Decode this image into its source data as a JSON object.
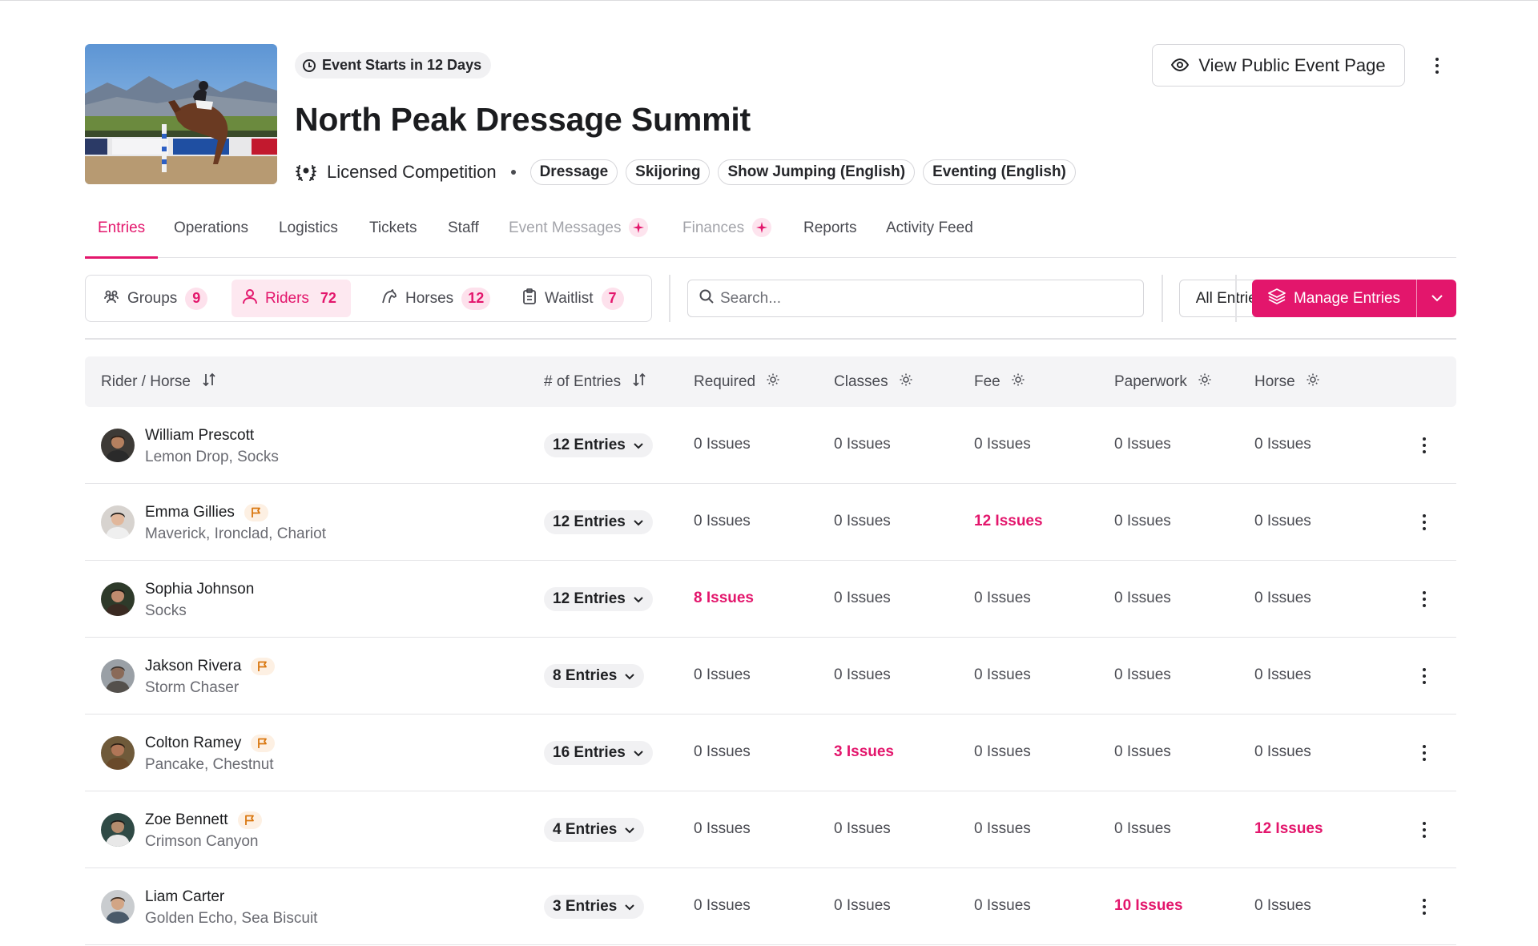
{
  "event": {
    "countdown": "Event Starts in 12 Days",
    "title": "North Peak Dressage Summit",
    "competition_type": "Licensed Competition",
    "disciplines": [
      "Dressage",
      "Skijoring",
      "Show Jumping (English)",
      "Eventing (English)"
    ],
    "view_button": "View Public Event Page"
  },
  "tabs": [
    {
      "label": "Entries",
      "state": "active"
    },
    {
      "label": "Operations",
      "state": "normal"
    },
    {
      "label": "Logistics",
      "state": "normal"
    },
    {
      "label": "Tickets",
      "state": "normal"
    },
    {
      "label": "Staff",
      "state": "normal"
    },
    {
      "label": "Event Messages",
      "state": "disabled"
    },
    {
      "label": "Finances",
      "state": "disabled"
    },
    {
      "label": "Reports",
      "state": "normal"
    },
    {
      "label": "Activity Feed",
      "state": "normal"
    }
  ],
  "segments": [
    {
      "label": "Groups",
      "count": "9",
      "icon": "groups-icon"
    },
    {
      "label": "Riders",
      "count": "72",
      "icon": "rider-icon",
      "active": true
    },
    {
      "label": "Horses",
      "count": "12",
      "icon": "horse-icon"
    },
    {
      "label": "Waitlist",
      "count": "7",
      "icon": "clipboard-icon"
    }
  ],
  "search": {
    "placeholder": "Search..."
  },
  "filter": {
    "selected": "All Entries"
  },
  "manage": {
    "label": "Manage Entries"
  },
  "table": {
    "headers": [
      "Rider / Horse",
      "# of Entries",
      "Required",
      "Classes",
      "Fee",
      "Paperwork",
      "Horse"
    ],
    "rows": [
      {
        "name": "William Prescott",
        "horses": "Lemon Drop, Socks",
        "flag": false,
        "entries": "12 Entries",
        "cells": [
          "0 Issues",
          "0 Issues",
          "0 Issues",
          "0 Issues",
          "0 Issues"
        ]
      },
      {
        "name": "Emma Gillies",
        "horses": "Maverick, Ironclad, Chariot",
        "flag": true,
        "entries": "12 Entries",
        "cells": [
          "0 Issues",
          "0 Issues",
          "12 Issues",
          "0 Issues",
          "0 Issues"
        ]
      },
      {
        "name": "Sophia Johnson",
        "horses": "Socks",
        "flag": false,
        "entries": "12 Entries",
        "cells": [
          "8 Issues",
          "0 Issues",
          "0 Issues",
          "0 Issues",
          "0 Issues"
        ]
      },
      {
        "name": "Jakson Rivera",
        "horses": "Storm Chaser",
        "flag": true,
        "entries": "8 Entries",
        "cells": [
          "0 Issues",
          "0 Issues",
          "0 Issues",
          "0 Issues",
          "0 Issues"
        ]
      },
      {
        "name": "Colton Ramey",
        "horses": "Pancake, Chestnut",
        "flag": true,
        "entries": "16 Entries",
        "cells": [
          "0 Issues",
          "3 Issues",
          "0 Issues",
          "0 Issues",
          "0 Issues"
        ]
      },
      {
        "name": "Zoe Bennett",
        "horses": "Crimson Canyon",
        "flag": true,
        "entries": "4 Entries",
        "cells": [
          "0 Issues",
          "0 Issues",
          "0 Issues",
          "0 Issues",
          "12 Issues"
        ]
      },
      {
        "name": "Liam Carter",
        "horses": "Golden Echo, Sea Biscuit",
        "flag": false,
        "entries": "3 Entries",
        "cells": [
          "0 Issues",
          "0 Issues",
          "0 Issues",
          "10 Issues",
          "0 Issues"
        ]
      }
    ]
  },
  "colors": {
    "accent": "#e3166c",
    "accent_soft": "#fde1ec",
    "flag": "#d9770f"
  }
}
